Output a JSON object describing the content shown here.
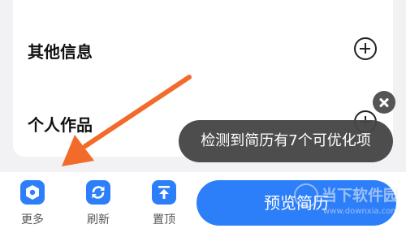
{
  "sections": [
    {
      "title": "其他信息",
      "action_icon": "plus-circle-icon"
    },
    {
      "title": "个人作品",
      "action_icon": "plus-circle-icon"
    }
  ],
  "toast": {
    "message": "检测到简历有7个可优化项",
    "close_icon": "close-icon"
  },
  "toolbar": {
    "items": [
      {
        "label": "更多",
        "icon": "hexagon-icon"
      },
      {
        "label": "刷新",
        "icon": "refresh-icon"
      },
      {
        "label": "置顶",
        "icon": "pin-top-icon"
      }
    ],
    "preview_label": "预览简历"
  },
  "watermark": {
    "title": "当下软件园",
    "url": "www.downxia.com"
  },
  "colors": {
    "accent": "#2d7ff9",
    "arrow": "#f26b2b",
    "toast_bg": "#464646",
    "background": "#f2f2f4"
  }
}
